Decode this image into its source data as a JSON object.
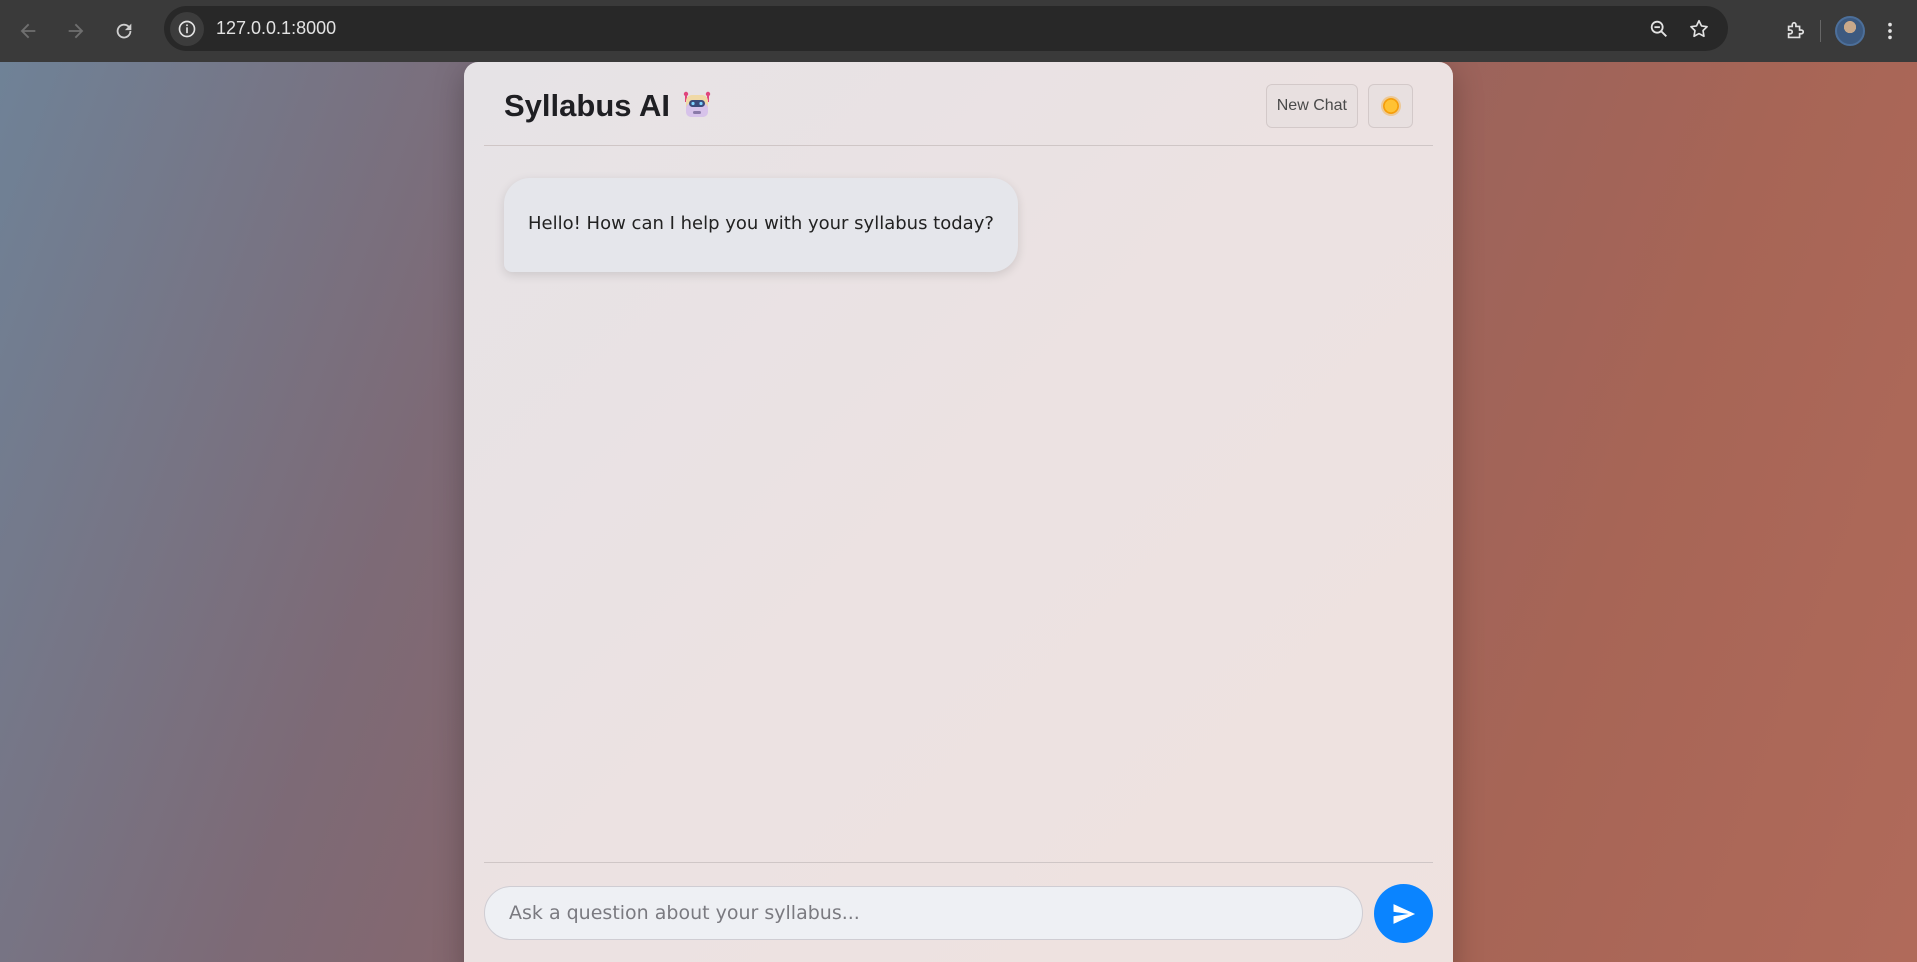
{
  "browser": {
    "url": "127.0.0.1:8000"
  },
  "app": {
    "title": "Syllabus AI",
    "title_icon": "robot-icon",
    "new_chat_label": "New Chat",
    "theme_icon": "sun-icon"
  },
  "messages": [
    {
      "role": "bot",
      "text": "Hello! How can I help you with your syllabus today?"
    }
  ],
  "composer": {
    "placeholder": "Ask a question about your syllabus...",
    "value": "",
    "send_icon": "send-icon"
  },
  "colors": {
    "accent": "#0a84ff",
    "card_bg": "#ece2e2",
    "bot_bubble": "#e5e6eb"
  }
}
